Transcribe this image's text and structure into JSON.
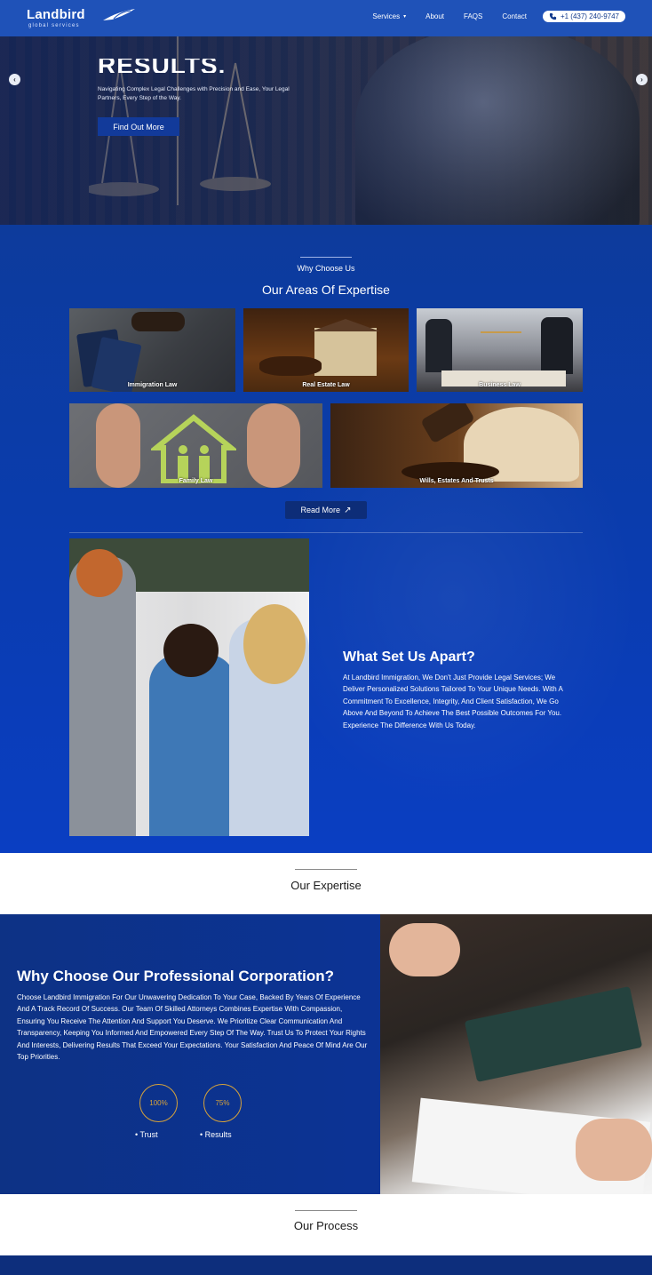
{
  "nav": {
    "logo_text": "Landbird",
    "logo_sub": "global services",
    "links": [
      "Services",
      "About",
      "FAQS",
      "Contact"
    ],
    "phone": "+1 (437) 240-9747"
  },
  "hero": {
    "title": "RESULTS.",
    "subtitle": "Navigating Complex Legal Challenges with Precision and Ease, Your Legal Partners, Every Step of the Way.",
    "cta": "Find Out More"
  },
  "expertise": {
    "eyebrow": "Why Choose Us",
    "title": "Our Areas Of Expertise",
    "cards": [
      {
        "label": "Immigration Law"
      },
      {
        "label": "Real Estate Law"
      },
      {
        "label": "Business Law"
      },
      {
        "label": "Family Law"
      },
      {
        "label": "Wills, Estates And Trusts"
      }
    ],
    "read_more": "Read More"
  },
  "apart": {
    "title": "What Set Us Apart?",
    "text": "At Landbird Immigration, We Don't Just Provide Legal Services; We Deliver Personalized Solutions Tailored To Your Unique Needs. With A Commitment To Excellence, Integrity, And Client Satisfaction, We Go Above And Beyond To Achieve The Best Possible Outcomes For You. Experience The Difference With Us Today."
  },
  "our_expertise": {
    "title": "Our Expertise"
  },
  "why": {
    "title": "Why Choose Our Professional Corporation?",
    "text": "Choose Landbird Immigration For Our Unwavering Dedication To Your Case, Backed By Years Of Experience And A Track Record Of Success. Our Team Of Skilled Attorneys Combines Expertise With Compassion, Ensuring You Receive The Attention And Support You Deserve. We Prioritize Clear Communication And Transparency, Keeping You Informed And Empowered Every Step Of The Way. Trust Us To Protect Your Rights And Interests, Delivering Results That Exceed Your Expectations. Your Satisfaction And Peace Of Mind Are Our Top Priorities.",
    "stats": [
      {
        "value": "100%",
        "label": "Trust"
      },
      {
        "value": "75%",
        "label": "Results"
      }
    ]
  },
  "process": {
    "title": "Our Process"
  },
  "colors": {
    "primary": "#0b3a9a",
    "accent": "#d6a23a",
    "nav": "#1f52b8"
  }
}
